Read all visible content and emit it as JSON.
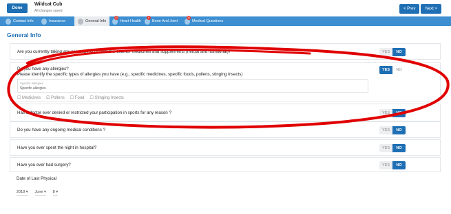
{
  "topbar": {
    "done_label": "Done",
    "title": "Wildcat Cub",
    "subtitle": "All changes saved",
    "prev_label": "< Prev",
    "next_label": "Next >"
  },
  "tabs": [
    {
      "label": "Contact Info",
      "icon": "person-icon",
      "badge": ""
    },
    {
      "label": "Insurance",
      "icon": "person-icon",
      "badge": ""
    },
    {
      "label": "General Info",
      "icon": "person-icon",
      "badge": "",
      "active": true
    },
    {
      "label": "Heart Health",
      "icon": "heart-icon",
      "badge": "10"
    },
    {
      "label": "Bone And Joint",
      "icon": "bone-icon",
      "badge": "6"
    },
    {
      "label": "Medical Questions",
      "icon": "medical-icon",
      "badge": "30"
    }
  ],
  "page_title": "General Info",
  "yes_label": "YES",
  "no_label": "NO",
  "questions": {
    "q1": {
      "text": "Are you currently taking any prescription or over-the-counter medicines and supplements (herbal and nutritional)?",
      "answer": "NO"
    },
    "q2": {
      "text": "Do you have any allergies?",
      "subtext": "Please identify the specific types of allergies you have (e.g., specific medicines, specific foods, pollens, stinging insects)",
      "answer": "YES",
      "textarea_placeholder": "Specific allergies",
      "textarea_value": "Specific allergies",
      "options": [
        {
          "label": "Medicines",
          "checked": false
        },
        {
          "label": "Pollens",
          "checked": true
        },
        {
          "label": "Food",
          "checked": false
        },
        {
          "label": "Stinging Insects",
          "checked": false
        }
      ]
    },
    "q3": {
      "text": "Has a doctor ever denied or restricted your participation in sports for any reason ?",
      "answer": "NO"
    },
    "q4": {
      "text": "Do you have any ongoing medical conditions ?",
      "answer": "NO"
    },
    "q5": {
      "text": "Have you ever spent the night in hospital?",
      "answer": "NO"
    },
    "q6": {
      "text": "Have you ever had surgery?",
      "answer": "NO"
    }
  },
  "physical": {
    "label": "Date of Last Physical",
    "year": "2018",
    "month": "June",
    "day": "8"
  },
  "colors": {
    "accent": "#1f6fb4",
    "tabbar": "#3d8fd1",
    "annotation": "#e00000"
  }
}
